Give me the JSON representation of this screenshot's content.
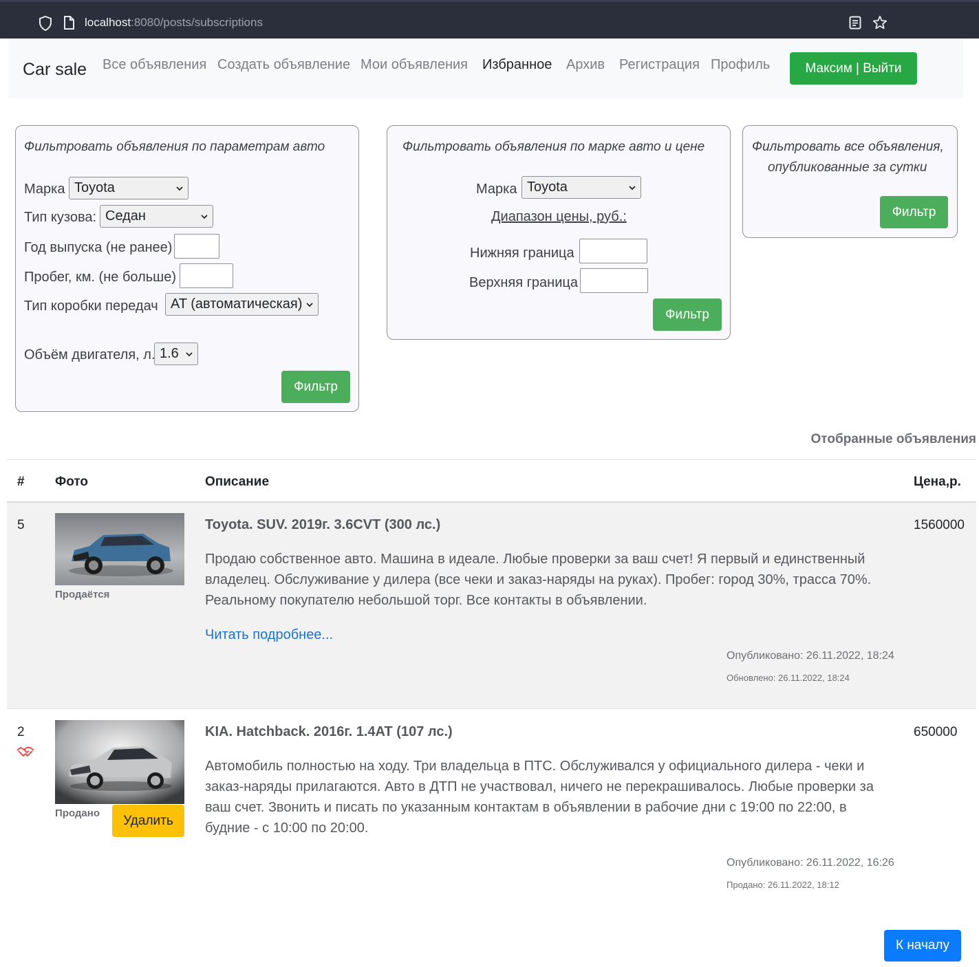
{
  "browser": {
    "url_host": "localhost",
    "url_rest": ":8080/posts/subscriptions"
  },
  "navbar": {
    "brand": "Car sale",
    "links": [
      {
        "label": "Все объявления"
      },
      {
        "label": "Создать объявление"
      },
      {
        "label": "Мои объявления"
      },
      {
        "label": "Избранное"
      },
      {
        "label": "Архив"
      },
      {
        "label": "Регистрация"
      },
      {
        "label": "Профиль"
      }
    ],
    "user_button": "Максим | Выйти"
  },
  "filter_params": {
    "title": "Фильтровать объявления по параметрам авто",
    "brand_label": "Марка",
    "brand_value": "Toyota",
    "body_label": "Тип кузова:",
    "body_value": "Седан",
    "year_label": "Год выпуска (не ранее)",
    "mileage_label": "Пробег, км. (не больше)",
    "gearbox_label": "Тип коробки передач",
    "gearbox_value": "AT (автоматическая)",
    "engine_label": "Объём двигателя, л.",
    "engine_value": "1.6",
    "button": "Фильтр"
  },
  "filter_price": {
    "title": "Фильтровать объявления по марке авто и цене",
    "brand_label": "Марка",
    "brand_value": "Toyota",
    "range_label": "Диапазон цены, руб.:",
    "lower_label": "Нижняя граница",
    "upper_label": "Верхняя граница",
    "button": "Фильтр"
  },
  "filter_day": {
    "title_line1": "Фильтровать все объявления,",
    "title_line2": "опубликованные за сутки",
    "button": "Фильтр"
  },
  "results": {
    "title": "Отобранные объявления",
    "headers": {
      "num": "#",
      "photo": "Фото",
      "description": "Описание",
      "price": "Цена,р."
    },
    "posts": [
      {
        "num": "5",
        "status": "Продаётся",
        "title": "Toyota. SUV. 2019г. 3.6CVT (300 лс.)",
        "description": "Продаю собственное авто. Машина в идеале. Любые проверки за ваш счет! Я первый и единственный владелец. Обслуживание у дилера (все чеки и заказ-наряды на руках). Пробег: город 30%, трасса 70%. Реальному покупателю небольшой торг. Все контакты в объявлении.",
        "link": "Читать подробнее...",
        "published": "Опубликовано: 26.11.2022, 18:24",
        "updated": "Обновлено: 26.11.2022, 18:24",
        "price": "1560000",
        "car_color": "#3e6f98"
      },
      {
        "num": "2",
        "status": "Продано",
        "title": "KIA. Hatchback. 2016г. 1.4AT (107 лс.)",
        "description": "Автомобиль полностью на ходу. Три владельца в ПТС. Обслуживался у официального дилера - чеки и заказ-наряды прилагаются. Авто в ДТП не участвовал, ничего не перекрашивалось. Любые проверки за ваш счет. Звонить и писать по указанным контактам в объявлении в рабочие дни с 19:00 по 22:00, в будние - с 10:00 по 20:00.",
        "published": "Опубликовано: 26.11.2022, 16:26",
        "sold": "Продано: 26.11.2022, 18:12",
        "price": "650000",
        "delete_button": "Удалить",
        "car_color": "#c4c6c8"
      }
    ],
    "top_button": "К началу"
  },
  "colors": {
    "green": "#28a745",
    "yellow": "#ffc107",
    "blue": "#0b7bff",
    "link": "#1a73c9"
  }
}
